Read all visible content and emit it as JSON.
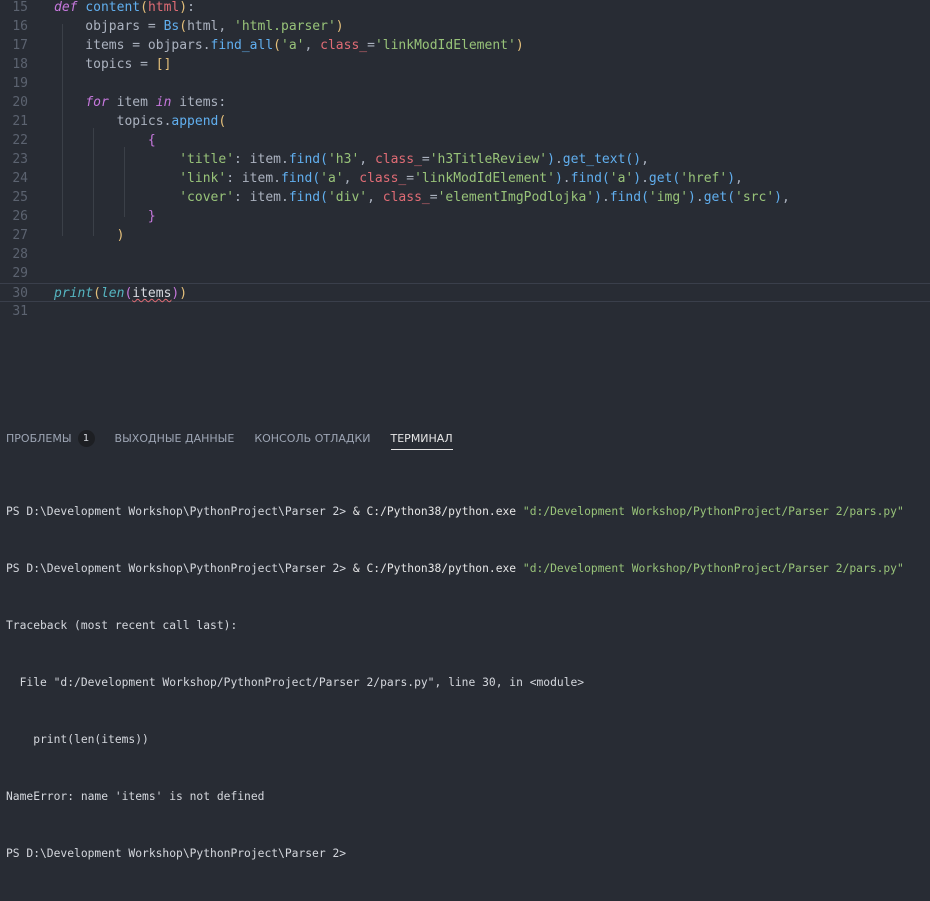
{
  "editor": {
    "lines": [
      {
        "n": "15",
        "tokens": [
          [
            "def",
            "kw"
          ],
          [
            " "
          ],
          [
            "content",
            "fn"
          ],
          [
            "(",
            "b1"
          ],
          [
            "html",
            "param"
          ],
          [
            ")",
            "b1"
          ],
          [
            ":"
          ]
        ]
      },
      {
        "n": "16",
        "tokens": [
          [
            "    objpars = "
          ],
          [
            "Bs",
            "fn"
          ],
          [
            "(",
            "b1"
          ],
          [
            "html, "
          ],
          [
            "'html.parser'",
            "str"
          ],
          [
            ")",
            "b1"
          ]
        ]
      },
      {
        "n": "17",
        "tokens": [
          [
            "    items = objpars."
          ],
          [
            "find_all",
            "fn"
          ],
          [
            "(",
            "b1"
          ],
          [
            "'a'",
            "str"
          ],
          [
            ", "
          ],
          [
            "class_",
            "param"
          ],
          [
            "="
          ],
          [
            "'linkModIdElement'",
            "str"
          ],
          [
            ")",
            "b1"
          ]
        ]
      },
      {
        "n": "18",
        "tokens": [
          [
            "    topics = "
          ],
          [
            "[]",
            "b1"
          ]
        ]
      },
      {
        "n": "19",
        "tokens": []
      },
      {
        "n": "20",
        "tokens": [
          [
            "    "
          ],
          [
            "for",
            "kw"
          ],
          [
            " item "
          ],
          [
            "in",
            "kw"
          ],
          [
            " items:"
          ]
        ]
      },
      {
        "n": "21",
        "tokens": [
          [
            "        topics."
          ],
          [
            "append",
            "fn"
          ],
          [
            "(",
            "b1"
          ]
        ]
      },
      {
        "n": "22",
        "tokens": [
          [
            "            "
          ],
          [
            "{",
            "b2"
          ]
        ]
      },
      {
        "n": "23",
        "tokens": [
          [
            "                "
          ],
          [
            "'title'",
            "str"
          ],
          [
            ": item."
          ],
          [
            "find",
            "fn"
          ],
          [
            "(",
            "b3"
          ],
          [
            "'h3'",
            "str"
          ],
          [
            ", "
          ],
          [
            "class_",
            "param"
          ],
          [
            "="
          ],
          [
            "'h3TitleReview'",
            "str"
          ],
          [
            ")",
            "b3"
          ],
          [
            "."
          ],
          [
            "get_text",
            "fn"
          ],
          [
            "()",
            "b3"
          ],
          [
            ","
          ]
        ]
      },
      {
        "n": "24",
        "tokens": [
          [
            "                "
          ],
          [
            "'link'",
            "str"
          ],
          [
            ": item."
          ],
          [
            "find",
            "fn"
          ],
          [
            "(",
            "b3"
          ],
          [
            "'a'",
            "str"
          ],
          [
            ", "
          ],
          [
            "class_",
            "param"
          ],
          [
            "="
          ],
          [
            "'linkModIdElement'",
            "str"
          ],
          [
            ")",
            "b3"
          ],
          [
            "."
          ],
          [
            "find",
            "fn"
          ],
          [
            "(",
            "b3"
          ],
          [
            "'a'",
            "str"
          ],
          [
            ")",
            "b3"
          ],
          [
            "."
          ],
          [
            "get",
            "fn"
          ],
          [
            "(",
            "b3"
          ],
          [
            "'href'",
            "str"
          ],
          [
            ")",
            "b3"
          ],
          [
            ","
          ]
        ]
      },
      {
        "n": "25",
        "tokens": [
          [
            "                "
          ],
          [
            "'cover'",
            "str"
          ],
          [
            ": item."
          ],
          [
            "find",
            "fn"
          ],
          [
            "(",
            "b3"
          ],
          [
            "'div'",
            "str"
          ],
          [
            ", "
          ],
          [
            "class_",
            "param"
          ],
          [
            "="
          ],
          [
            "'elementImgPodlojka'",
            "str"
          ],
          [
            ")",
            "b3"
          ],
          [
            "."
          ],
          [
            "find",
            "fn"
          ],
          [
            "(",
            "b3"
          ],
          [
            "'img'",
            "str"
          ],
          [
            ")",
            "b3"
          ],
          [
            "."
          ],
          [
            "get",
            "fn"
          ],
          [
            "(",
            "b3"
          ],
          [
            "'src'",
            "str"
          ],
          [
            ")",
            "b3"
          ],
          [
            ","
          ]
        ]
      },
      {
        "n": "26",
        "tokens": [
          [
            "            "
          ],
          [
            "}",
            "b2"
          ]
        ]
      },
      {
        "n": "27",
        "tokens": [
          [
            "        "
          ],
          [
            ")",
            "b1"
          ]
        ]
      },
      {
        "n": "28",
        "tokens": []
      },
      {
        "n": "29",
        "tokens": []
      },
      {
        "n": "30",
        "tokens": [
          [
            "print",
            "bi"
          ],
          [
            "(",
            "b1"
          ],
          [
            "len",
            "bi"
          ],
          [
            "(",
            "b2"
          ],
          [
            "items",
            "var err"
          ],
          [
            ")",
            "b2"
          ],
          [
            ")",
            "b1"
          ]
        ]
      },
      {
        "n": "31",
        "tokens": []
      }
    ]
  },
  "panel": {
    "tabs": [
      {
        "label": "ПРОБЛЕМЫ",
        "badge": "1"
      },
      {
        "label": "ВЫХОДНЫЕ ДАННЫЕ"
      },
      {
        "label": "КОНСОЛЬ ОТЛАДКИ"
      },
      {
        "label": "ТЕРМИНАЛ",
        "active": true
      }
    ],
    "terminal": [
      {
        "prompt": "PS D:\\Development Workshop\\PythonProject\\Parser 2> ",
        "cmd": "& C:/Python38/python.exe",
        "arg": " \"d:/Development Workshop/PythonProject/Parser 2/pars.py\""
      },
      {
        "prompt": "PS D:\\Development Workshop\\PythonProject\\Parser 2> ",
        "cmd": "& C:/Python38/python.exe",
        "arg": " \"d:/Development Workshop/PythonProject/Parser 2/pars.py\""
      },
      {
        "text": "Traceback (most recent call last):"
      },
      {
        "text": "  File \"d:/Development Workshop/PythonProject/Parser 2/pars.py\", line 30, in <module>"
      },
      {
        "text": "    print(len(items))"
      },
      {
        "text": "NameError: name 'items' is not defined"
      },
      {
        "text": "PS D:\\Development Workshop\\PythonProject\\Parser 2>"
      }
    ]
  }
}
